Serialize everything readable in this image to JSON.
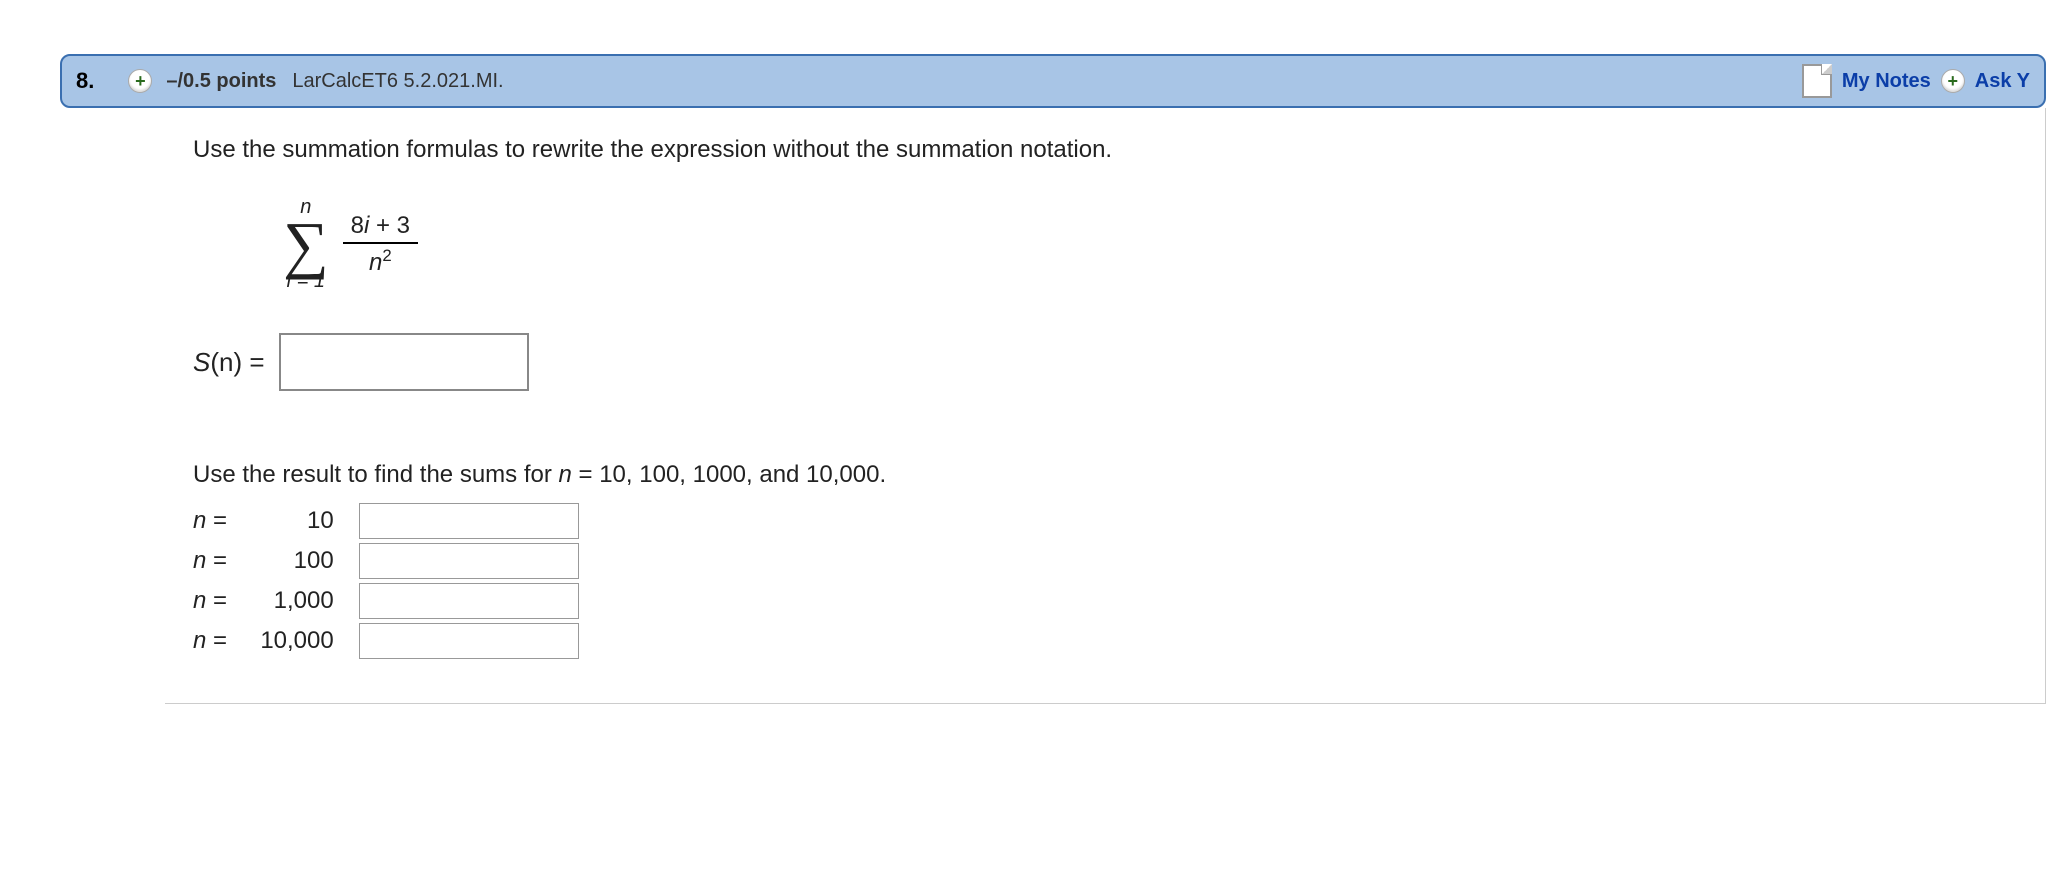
{
  "header": {
    "number": "8.",
    "expand_glyph": "+",
    "points": "–/0.5 points",
    "reference": "LarCalcET6 5.2.021.MI.",
    "notes_label": "My Notes",
    "ask_label": "Ask Y"
  },
  "body": {
    "instruction1": "Use the summation formulas to rewrite the expression without the summation notation.",
    "sigma_upper": "n",
    "sigma_lower_var": "i",
    "sigma_lower_op": " = 1",
    "numerator_coeff": "8",
    "numerator_var": "i",
    "numerator_rest": " + 3",
    "denominator_var": "n",
    "denominator_exp": "2",
    "sn_label_func": "S",
    "sn_label_arg": "(n)",
    "sn_label_eq": " =",
    "instruction2_pre": "Use the result to find the sums for ",
    "instruction2_var": "n",
    "instruction2_post": " = 10, 100, 1000, and 10,000.",
    "rows": [
      {
        "label_var": "n",
        "label_eq": " = ",
        "value": "10"
      },
      {
        "label_var": "n",
        "label_eq": " = ",
        "value": "100"
      },
      {
        "label_var": "n",
        "label_eq": " = ",
        "value": "1,000"
      },
      {
        "label_var": "n",
        "label_eq": " = ",
        "value": "10,000"
      }
    ]
  }
}
